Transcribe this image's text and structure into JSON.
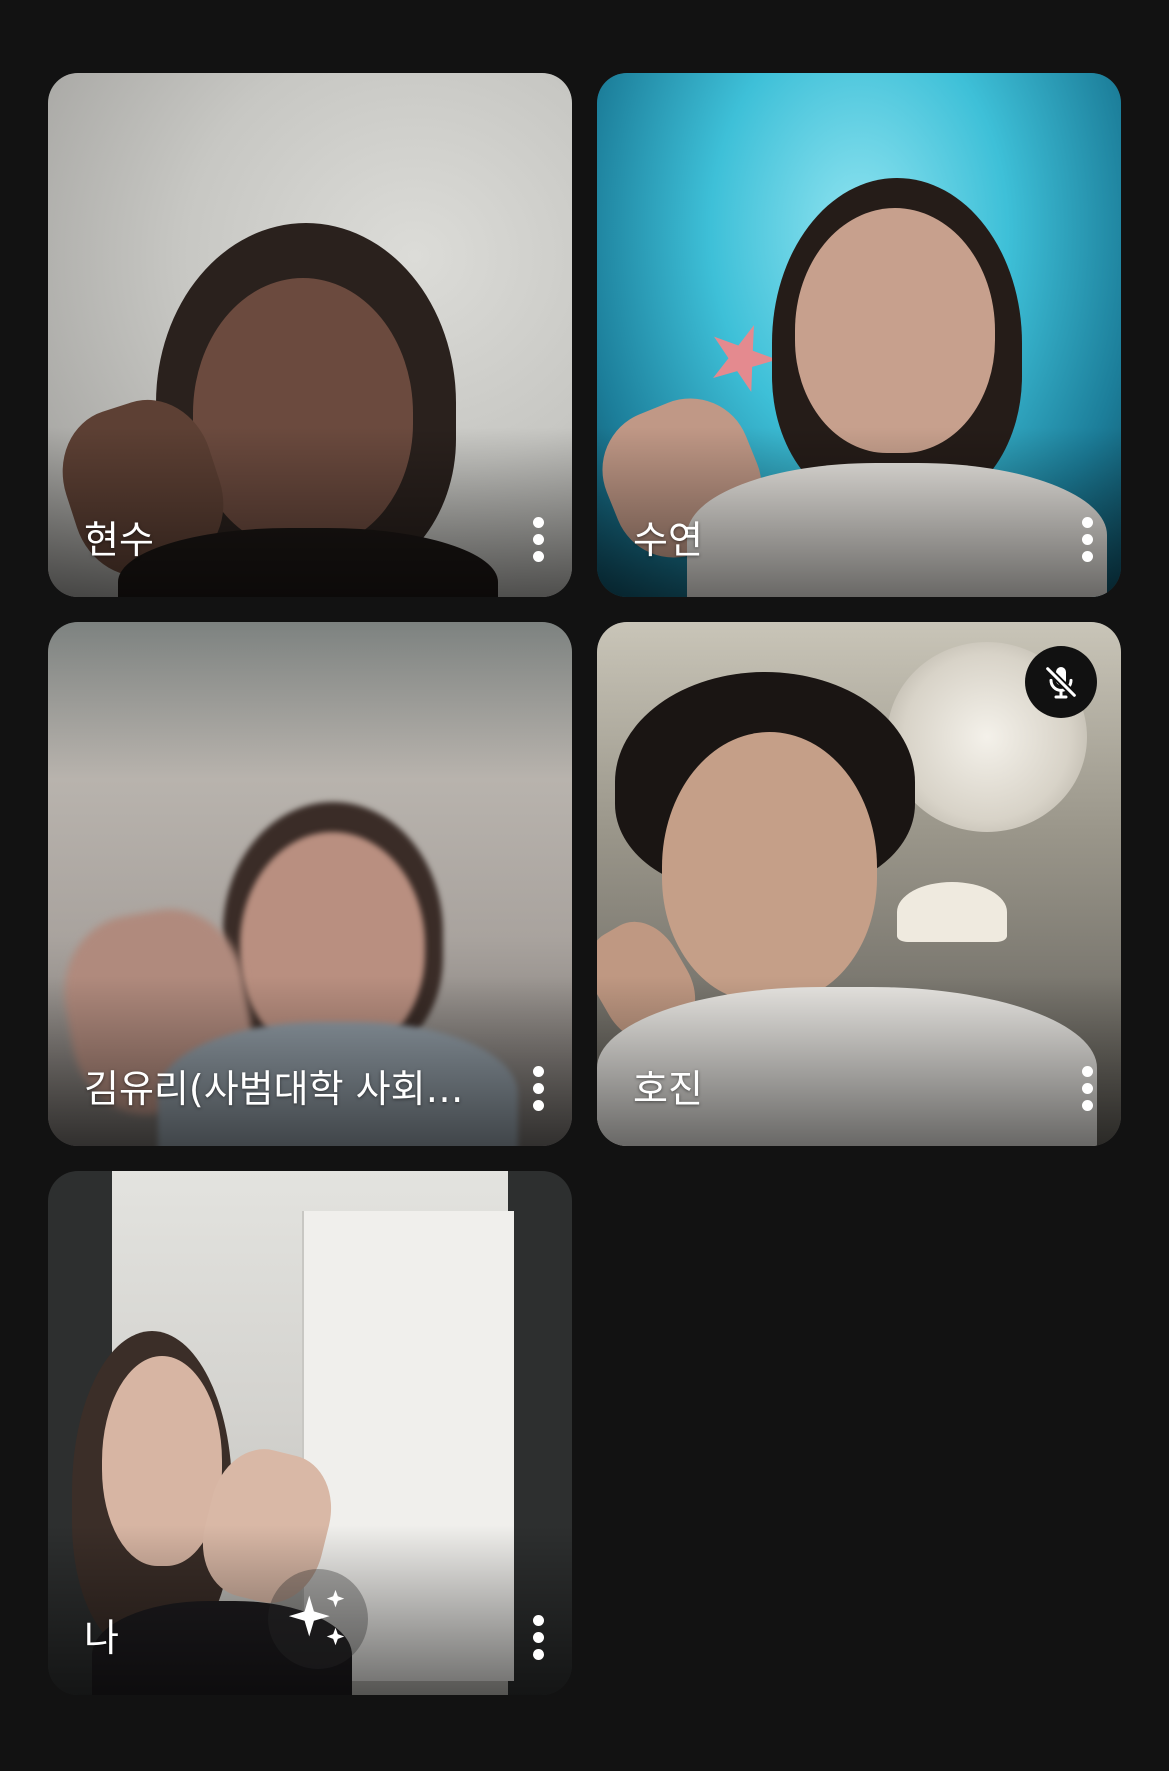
{
  "participants": [
    {
      "name": "현수",
      "muted": false
    },
    {
      "name": "수연",
      "muted": false
    },
    {
      "name": "김유리(사범대학 사회…",
      "muted": false
    },
    {
      "name": "호진",
      "muted": true
    },
    {
      "name": "나",
      "muted": false,
      "is_self": true
    }
  ],
  "icons": {
    "more": "more-vert-icon",
    "mute": "mic-off-icon",
    "effects": "sparkle-effects-icon"
  },
  "colors": {
    "background": "#121212",
    "tile_overlay_text": "#ffffff",
    "mute_badge": "#111111"
  }
}
